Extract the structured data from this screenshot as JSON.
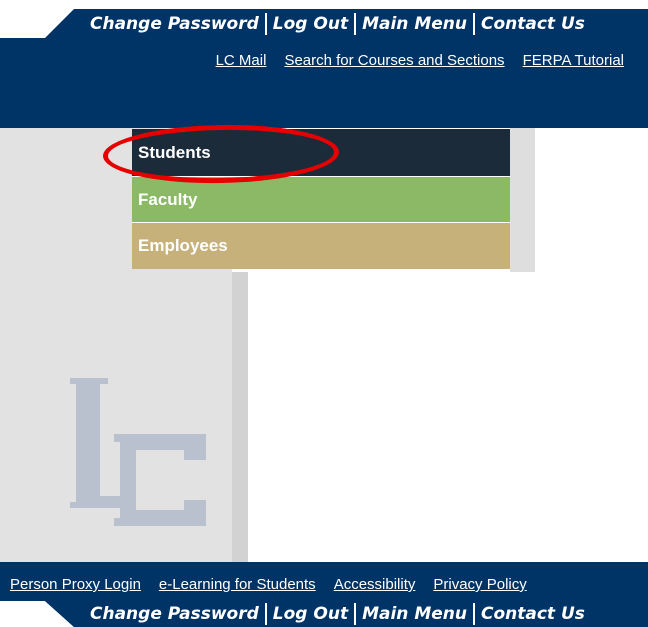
{
  "top_nav": {
    "items": [
      "Change Password",
      "Log Out",
      "Main Menu",
      "Contact Us"
    ]
  },
  "header": {
    "links": [
      "LC Mail",
      "Search for Courses and Sections",
      "FERPA Tutorial"
    ]
  },
  "menu": {
    "items": [
      "Students",
      "Faculty",
      "Employees"
    ]
  },
  "footer": {
    "links": [
      "Person Proxy Login",
      "e-Learning for Students",
      "Accessibility",
      "Privacy Policy"
    ]
  },
  "bottom_nav": {
    "items": [
      "Change Password",
      "Log Out",
      "Main Menu",
      "Contact Us"
    ]
  },
  "logo": {
    "text": "LC",
    "icon": "lc-monogram-logo"
  },
  "annotation": {
    "shape": "ellipse",
    "target": "Students",
    "color": "#e60000"
  },
  "colors": {
    "navy": "#003366",
    "students_bg": "#1c2b3a",
    "faculty_bg": "#8bb965",
    "employees_bg": "#c7b17b",
    "logo_gray": "#b9c1cf"
  }
}
